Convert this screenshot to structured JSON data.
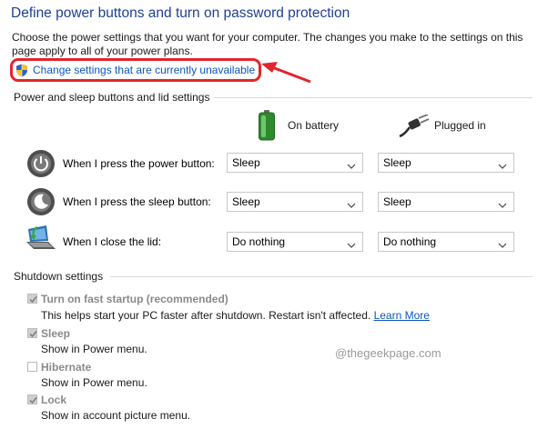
{
  "title": "Define power buttons and turn on password protection",
  "intro": "Choose the power settings that you want for your computer. The changes you make to the settings on this page apply to all of your power plans.",
  "change_link": {
    "label": "Change settings that are currently unavailable",
    "icon": "shield-icon"
  },
  "power_section": {
    "label": "Power and sleep buttons and lid settings",
    "columns": {
      "battery": "On battery",
      "plugged": "Plugged in"
    },
    "rows": [
      {
        "label": "When I press the power button:",
        "battery": "Sleep",
        "plugged": "Sleep",
        "icon": "power-button-icon"
      },
      {
        "label": "When I press the sleep button:",
        "battery": "Sleep",
        "plugged": "Sleep",
        "icon": "sleep-button-icon"
      },
      {
        "label": "When I close the lid:",
        "battery": "Do nothing",
        "plugged": "Do nothing",
        "icon": "laptop-lid-icon"
      }
    ]
  },
  "shutdown_section": {
    "label": "Shutdown settings",
    "options": [
      {
        "title": "Turn on fast startup (recommended)",
        "desc": "This helps start your PC faster after shutdown. Restart isn't affected.",
        "link": "Learn More",
        "checked": true
      },
      {
        "title": "Sleep",
        "desc": "Show in Power menu.",
        "checked": true
      },
      {
        "title": "Hibernate",
        "desc": "Show in Power menu.",
        "checked": false
      },
      {
        "title": "Lock",
        "desc": "Show in account picture menu.",
        "checked": true
      }
    ]
  },
  "watermark": "@thegeekpage.com",
  "colors": {
    "title": "#1e3f94",
    "link": "#0a56c2",
    "highlight": "#e0262b",
    "disabled_text": "#8a8a8a"
  }
}
